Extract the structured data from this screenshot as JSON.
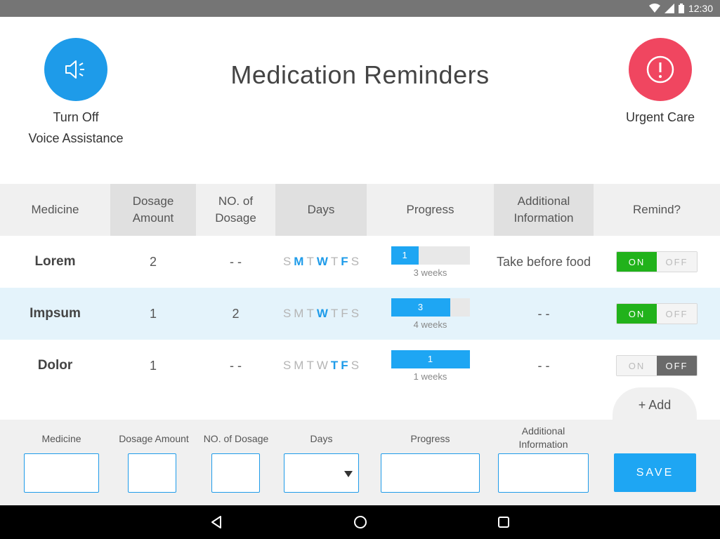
{
  "status_bar": {
    "time": "12:30",
    "icons": [
      "wifi-icon",
      "signal-icon",
      "battery-icon"
    ]
  },
  "header": {
    "title": "Medication Reminders",
    "voice_button": {
      "icon": "speaker-icon",
      "label_line1": "Turn Off",
      "label_line2": "Voice Assistance",
      "color": "#1e9be9"
    },
    "urgent_button": {
      "icon": "alert-icon",
      "label": "Urgent Care",
      "color": "#f04660"
    }
  },
  "table": {
    "headers": {
      "medicine": "Medicine",
      "dosage_amount_l1": "Dosage",
      "dosage_amount_l2": "Amount",
      "no_dosage_l1": "NO. of",
      "no_dosage_l2": "Dosage",
      "days": "Days",
      "progress": "Progress",
      "additional_l1": "Additional",
      "additional_l2": "Information",
      "remind": "Remind?"
    },
    "day_letters": [
      "S",
      "M",
      "T",
      "W",
      "T",
      "F",
      "S"
    ],
    "rows": [
      {
        "name": "Lorem",
        "dosage": "2",
        "count": "- -",
        "days_on": [
          false,
          true,
          false,
          true,
          false,
          true,
          false
        ],
        "progress_value": "1",
        "progress_fraction": 0.35,
        "progress_label": "3 weeks",
        "info": "Take before food",
        "remind": true,
        "toggle_on": "ON",
        "toggle_off": "OFF"
      },
      {
        "name": "Impsum",
        "dosage": "1",
        "count": "2",
        "days_on": [
          false,
          false,
          false,
          true,
          false,
          false,
          false
        ],
        "progress_value": "3",
        "progress_fraction": 0.75,
        "progress_label": "4 weeks",
        "info": "- -",
        "remind": true,
        "toggle_on": "ON",
        "toggle_off": "OFF"
      },
      {
        "name": "Dolor",
        "dosage": "1",
        "count": "- -",
        "days_on": [
          false,
          false,
          false,
          false,
          true,
          true,
          false
        ],
        "progress_value": "1",
        "progress_fraction": 1.0,
        "progress_label": "1 weeks",
        "info": "- -",
        "remind": false,
        "toggle_on": "ON",
        "toggle_off": "OFF"
      }
    ]
  },
  "add_button": "+ Add",
  "form": {
    "medicine": "Medicine",
    "dosage_amount": "Dosage Amount",
    "no_dosage": "NO. of Dosage",
    "days": "Days",
    "progress": "Progress",
    "additional_l1": "Additional",
    "additional_l2": "Information",
    "save": "SAVE"
  },
  "colors": {
    "accent": "#1ea6f3",
    "on": "#21b21b",
    "off": "#6a6a6a",
    "urgent": "#f04660",
    "highlight_row": "#e4f3fb"
  }
}
